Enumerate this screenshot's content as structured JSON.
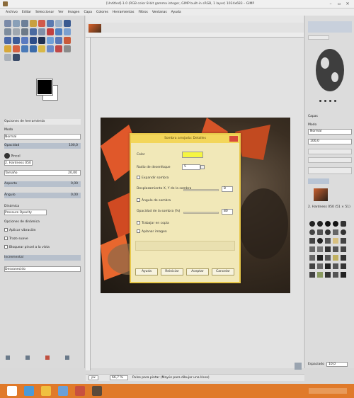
{
  "window": {
    "title": "[Untitled]-1.0 (RGB color 8-bit gamma integer, GIMP built-in sRGB, 1 layer) 1024x683 – GIMP",
    "min": "–",
    "max": "▫",
    "close": "✕"
  },
  "menu": [
    "Archivo",
    "Editar",
    "Seleccionar",
    "Ver",
    "Imagen",
    "Capa",
    "Colores",
    "Herramientas",
    "Filtros",
    "Ventanas",
    "Ayuda"
  ],
  "toolbox": {
    "options_title": "Opciones de herramienta",
    "mode_label": "Modo",
    "mode_value": "Normal",
    "opacity_label": "Opacidad",
    "opacity_value": "100,0",
    "brush_label": "Pincel",
    "brush_value": "2. Hardness 050",
    "size_label": "Tamaño",
    "size_value": "20,00",
    "aspect_label": "Aspecto",
    "aspect_value": "0,00",
    "angle_label": "Ángulo",
    "angle_value": "0,00",
    "dynamics_label": "Dinámica",
    "dynamics_value": "Pressure Opacity",
    "dyn_options": "Opciones de dinámica",
    "jitter": "Aplicar vibración",
    "smooth": "Trazo suave",
    "lock_brush": "Bloquear pincel a la vista",
    "incremental": "Incremental",
    "fade": "Desvanecido"
  },
  "dialog": {
    "title": "Sombra arrojada: Detalles",
    "color_label": "Color",
    "blur_label": "Radio de desenfoque",
    "blur_value": "5",
    "expand_label": "Expandir sombra",
    "offset_label": "Desplazamiento X, Y de la sombra",
    "offset_value": "8",
    "angle_label": "Ángulo de sombra",
    "opacity_label": "Opacidad de la sombra (%)",
    "opacity_value": "80",
    "keep_label": "Trabajar en copia",
    "flatten_label": "Aplanar imagen",
    "buttons": {
      "help": "Ayuda",
      "reset": "Reiniciar",
      "ok": "Aceptar",
      "cancel": "Cancelar"
    },
    "accent": "#f3d65a",
    "swatch_color": "#f5f542"
  },
  "status": {
    "units": "px",
    "zoom": "66,7 %",
    "message": "Pulse para pintar (Mayús para dibujar una línea)"
  },
  "dock": {
    "layers_label": "Capas",
    "mode_label": "Modo",
    "mode_value": "Normal",
    "opacity_value": "100,0",
    "brushes_label": "Pinceles",
    "brush_name": "2. Hardness 050 (51 × 51)",
    "spacing_label": "Espaciado",
    "spacing_value": "10,0"
  }
}
